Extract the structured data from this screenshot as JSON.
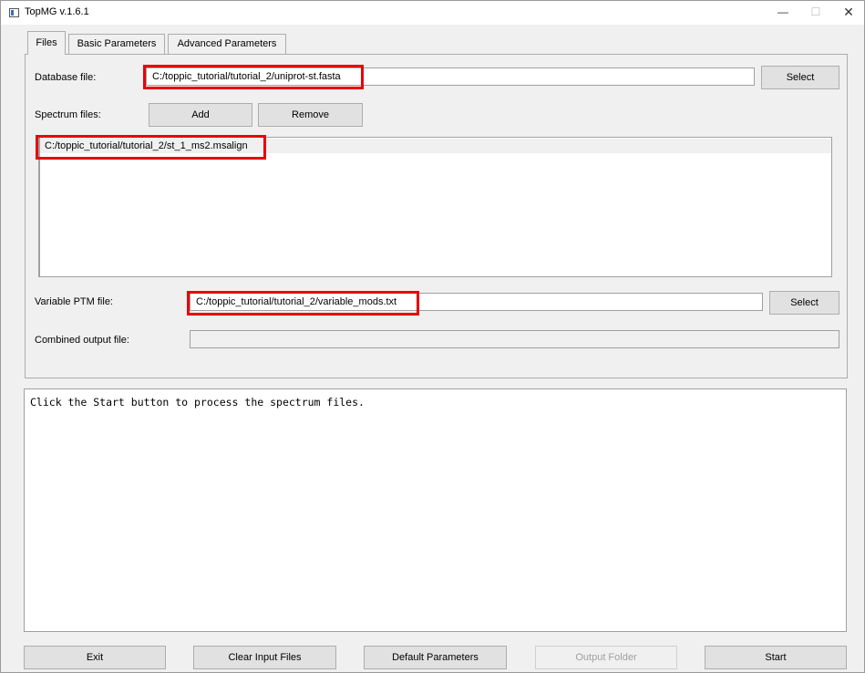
{
  "window": {
    "title": "TopMG v.1.6.1",
    "controls": {
      "minimize": "—",
      "maximize": "☐",
      "close": "✕"
    }
  },
  "tabs": [
    {
      "label": "Files",
      "active": true
    },
    {
      "label": "Basic Parameters",
      "active": false
    },
    {
      "label": "Advanced Parameters",
      "active": false
    }
  ],
  "files_tab": {
    "database": {
      "label": "Database file:",
      "value": "C:/toppic_tutorial/tutorial_2/uniprot-st.fasta",
      "select_label": "Select"
    },
    "spectrum": {
      "label": "Spectrum files:",
      "add_label": "Add",
      "remove_label": "Remove",
      "files": [
        "C:/toppic_tutorial/tutorial_2/st_1_ms2.msalign"
      ]
    },
    "variable_ptm": {
      "label": "Variable PTM file:",
      "value": "C:/toppic_tutorial/tutorial_2/variable_mods.txt",
      "select_label": "Select"
    },
    "combined_output": {
      "label": "Combined output file:",
      "value": ""
    }
  },
  "log": {
    "text": "Click the Start button to process the spectrum files."
  },
  "bottom_buttons": {
    "exit": "Exit",
    "clear": "Clear Input Files",
    "default": "Default Parameters",
    "output": "Output Folder",
    "start": "Start"
  },
  "colors": {
    "highlight": "#e8000b",
    "window_bg": "#f0f0f0",
    "button_bg": "#e1e1e1"
  }
}
